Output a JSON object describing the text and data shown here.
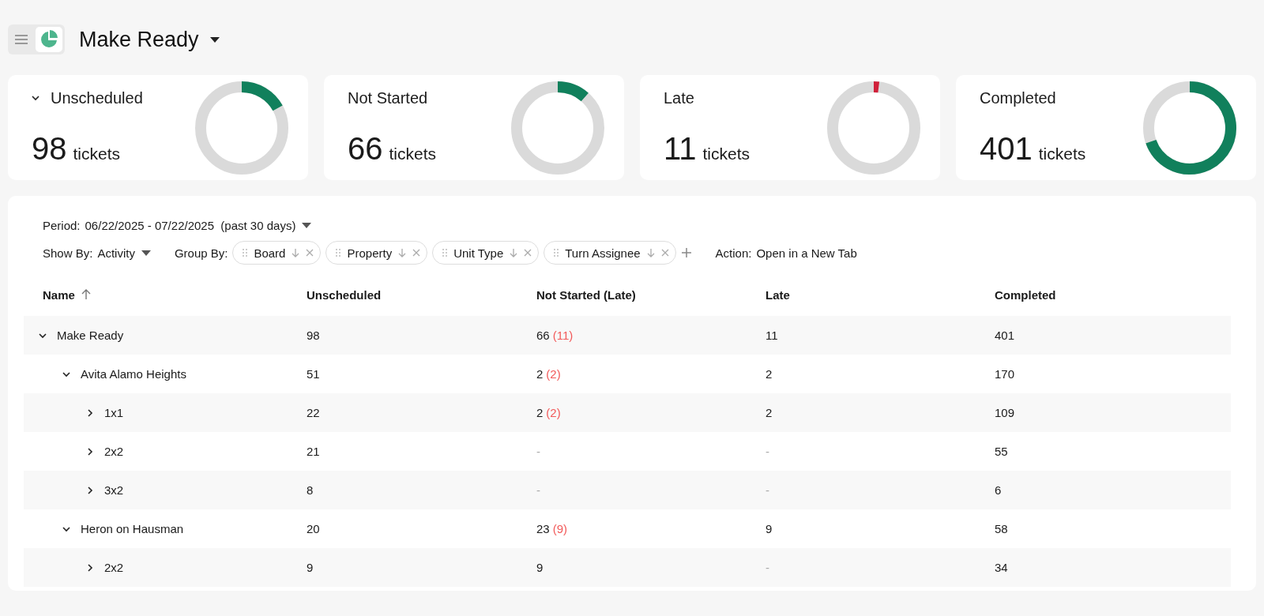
{
  "header": {
    "title": "Make Ready"
  },
  "summary_cards": [
    {
      "label": "Unscheduled",
      "count": "98",
      "unit": "tickets",
      "collapsible": true,
      "color": "#11805c"
    },
    {
      "label": "Not Started",
      "count": "66",
      "unit": "tickets",
      "collapsible": false,
      "color": "#11805c"
    },
    {
      "label": "Late",
      "count": "11",
      "unit": "tickets",
      "collapsible": false,
      "color": "#d0203a"
    },
    {
      "label": "Completed",
      "count": "401",
      "unit": "tickets",
      "collapsible": false,
      "color": "#11805c"
    }
  ],
  "filters": {
    "period_label": "Period:",
    "period_value": "06/22/2025 - 07/22/2025",
    "period_note": "(past 30 days)",
    "show_by_label": "Show By:",
    "show_by_value": "Activity",
    "group_by_label": "Group By:",
    "group_by": [
      "Board",
      "Property",
      "Unit Type",
      "Turn Assignee"
    ],
    "action_label": "Action:",
    "action_value": "Open in a New Tab"
  },
  "table": {
    "columns": [
      {
        "label": "Name",
        "sorted": true
      },
      {
        "label": "Unscheduled",
        "sorted": false
      },
      {
        "label": "Not Started (Late)",
        "sorted": false
      },
      {
        "label": "Late",
        "sorted": false
      },
      {
        "label": "Completed",
        "sorted": false
      }
    ],
    "rows": [
      {
        "name": "Make Ready",
        "expanded": true,
        "unscheduled": {
          "text": "98",
          "muted": false
        },
        "not_started": {
          "text": "66",
          "muted": false
        },
        "not_started_late": "(11)",
        "late": {
          "text": "11",
          "muted": false
        },
        "completed": {
          "text": "401",
          "muted": false
        },
        "children": [
          {
            "name": "Avita Alamo Heights",
            "expanded": true,
            "unscheduled": {
              "text": "51",
              "muted": false
            },
            "not_started": {
              "text": "2",
              "muted": false
            },
            "not_started_late": "(2)",
            "late": {
              "text": "2",
              "muted": false
            },
            "completed": {
              "text": "170",
              "muted": false
            },
            "children": [
              {
                "name": "1x1",
                "expanded": false,
                "unscheduled": {
                  "text": "22",
                  "muted": false
                },
                "not_started": {
                  "text": "2",
                  "muted": false
                },
                "not_started_late": "(2)",
                "late": {
                  "text": "2",
                  "muted": false
                },
                "completed": {
                  "text": "109",
                  "muted": false
                }
              },
              {
                "name": "2x2",
                "expanded": false,
                "unscheduled": {
                  "text": "21",
                  "muted": false
                },
                "not_started": {
                  "text": "-",
                  "muted": true
                },
                "late": {
                  "text": "-",
                  "muted": true
                },
                "completed": {
                  "text": "55",
                  "muted": false
                }
              },
              {
                "name": "3x2",
                "expanded": false,
                "unscheduled": {
                  "text": "8",
                  "muted": false
                },
                "not_started": {
                  "text": "-",
                  "muted": true
                },
                "late": {
                  "text": "-",
                  "muted": true
                },
                "completed": {
                  "text": "6",
                  "muted": false
                }
              }
            ]
          },
          {
            "name": "Heron on Hausman",
            "expanded": true,
            "unscheduled": {
              "text": "20",
              "muted": false
            },
            "not_started": {
              "text": "23",
              "muted": false
            },
            "not_started_late": "(9)",
            "late": {
              "text": "9",
              "muted": false
            },
            "completed": {
              "text": "58",
              "muted": false
            },
            "children": [
              {
                "name": "2x2",
                "expanded": false,
                "unscheduled": {
                  "text": "9",
                  "muted": false
                },
                "not_started": {
                  "text": "9",
                  "muted": false
                },
                "late": {
                  "text": "-",
                  "muted": true
                },
                "completed": {
                  "text": "34",
                  "muted": false
                }
              }
            ]
          }
        ]
      }
    ]
  }
}
